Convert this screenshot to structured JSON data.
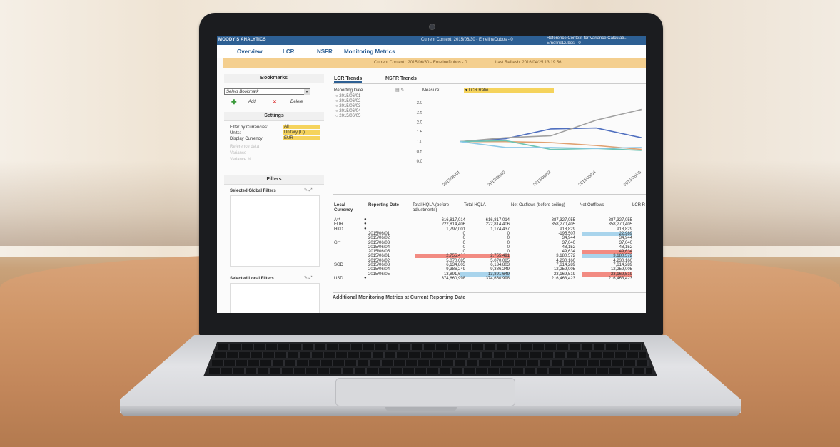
{
  "app": {
    "brand": "MOODY'S ANALYTICS",
    "current_context_top": "Current Context: 2015/06/30 - EmelineDubos - 0",
    "reference_context": "Reference Context for Variance Calculati... EmelineDubos - 0"
  },
  "nav": {
    "tabs": [
      "Overview",
      "LCR",
      "NSFR",
      "Monitoring Metrics"
    ]
  },
  "banner": {
    "current_context": "Current Context : 2015/06/30 - EmelineDubos - 0",
    "last_refresh": "Last Refresh: 2016/04/25 13:19:56"
  },
  "bookmarks": {
    "title": "Bookmarks",
    "select_placeholder": "Select Bookmark",
    "add_label": "Add",
    "delete_label": "Delete"
  },
  "settings": {
    "title": "Settings",
    "filter_label": "Filter by Currencies:",
    "filter_value": "All",
    "units_label": "Units:",
    "units_value": "Unitary (U)",
    "display_label": "Display Currency:",
    "display_value": "EUR",
    "reference_data": "Reference data",
    "variance": "Variance",
    "variance_pct": "Variance %"
  },
  "filters": {
    "title": "Filters",
    "global": "Selected Global Filters",
    "local": "Selected Local Filters"
  },
  "main": {
    "tabs": [
      "LCR Trends",
      "NSFR Trends"
    ],
    "reporting_date_label": "Reporting Date",
    "dates": [
      "2015/06/01",
      "2015/06/02",
      "2015/06/03",
      "2015/06/04",
      "2015/06/05"
    ],
    "measure_label": "Measure:",
    "measure_value": "LCR Ratio",
    "footer_title": "Additional Monitoring Metrics at Current Reporting Date"
  },
  "chart_data": {
    "type": "line",
    "x": [
      "2015/06/01",
      "2015/06/02",
      "2015/06/03",
      "2015/06/04",
      "2015/06/05"
    ],
    "y_ticks": [
      "0.0",
      "0.5",
      "1.0",
      "1.5",
      "2.0",
      "2.5",
      "3.0"
    ],
    "ylim": [
      0,
      3.0
    ],
    "series": [
      {
        "color": "#4f6fbf",
        "values": [
          1.0,
          1.15,
          1.65,
          1.7,
          1.2
        ]
      },
      {
        "color": "#a0a0a0",
        "values": [
          1.0,
          1.2,
          1.3,
          2.1,
          2.65
        ]
      },
      {
        "color": "#e0a070",
        "values": [
          1.0,
          1.0,
          0.95,
          0.8,
          0.6
        ]
      },
      {
        "color": "#6cc4b4",
        "values": [
          1.0,
          1.05,
          0.6,
          0.65,
          0.55
        ]
      },
      {
        "color": "#8cc8e8",
        "values": [
          1.0,
          0.7,
          0.7,
          0.65,
          0.7
        ]
      }
    ]
  },
  "table": {
    "headers": [
      "Local Currency",
      "Reporting Date",
      "Total HQLA (before adjustments)",
      "Total HQLA",
      "Net Outflows (before ceiling)",
      "Net Outflows",
      "LCR R"
    ],
    "rows": [
      {
        "cur": "A**",
        "date": "",
        "a": "616,817,014",
        "b": "616,817,014",
        "c": "887,327,055",
        "d": "887,327,055",
        "hb": "",
        "hd": ""
      },
      {
        "cur": "EUR",
        "date": "",
        "a": "222,814,406",
        "b": "222,814,406",
        "c": "358,270,405",
        "d": "358,270,405",
        "hb": "",
        "hd": ""
      },
      {
        "cur": "HKD",
        "date": "",
        "a": "1,797,001",
        "b": "1,174,437",
        "c": "918,829",
        "d": "918,829",
        "hb": "",
        "hd": ""
      },
      {
        "cur": "",
        "date": "2015/06/01",
        "a": "0",
        "b": "0",
        "c": "-195,507",
        "d": "22,989",
        "hb": "",
        "hd": "blue"
      },
      {
        "cur": "",
        "date": "2015/06/02",
        "a": "0",
        "b": "0",
        "c": "34,944",
        "d": "34,944",
        "hb": "",
        "hd": ""
      },
      {
        "cur": "G**",
        "date": "2015/06/03",
        "a": "0",
        "b": "0",
        "c": "37,040",
        "d": "37,040",
        "hb": "",
        "hd": ""
      },
      {
        "cur": "",
        "date": "2015/06/04",
        "a": "0",
        "b": "0",
        "c": "48,152",
        "d": "48,152",
        "hb": "",
        "hd": ""
      },
      {
        "cur": "",
        "date": "2015/06/05",
        "a": "0",
        "b": "0",
        "c": "49,634",
        "d": "49,634",
        "hb": "",
        "hd": "red"
      },
      {
        "cur": "",
        "date": "2015/06/01",
        "a": "2,755,491",
        "b": "2,755,491",
        "c": "3,180,572",
        "d": "3,180,572",
        "hb": "red",
        "hd": "blue"
      },
      {
        "cur": "",
        "date": "2015/06/02",
        "a": "5,070,085",
        "b": "5,070,085",
        "c": "4,230,160",
        "d": "4,230,160",
        "hb": "",
        "hd": ""
      },
      {
        "cur": "SGD",
        "date": "2015/06/03",
        "a": "6,134,803",
        "b": "6,134,803",
        "c": "7,614,289",
        "d": "7,614,289",
        "hb": "",
        "hd": ""
      },
      {
        "cur": "",
        "date": "2015/06/04",
        "a": "9,386,249",
        "b": "9,386,249",
        "c": "12,259,005",
        "d": "12,259,005",
        "hb": "",
        "hd": ""
      },
      {
        "cur": "",
        "date": "2015/06/05",
        "a": "13,891,649",
        "b": "13,891,649",
        "c": "23,169,519",
        "d": "23,169,519",
        "hb": "blue",
        "hd": "red"
      },
      {
        "cur": "USD",
        "date": "",
        "a": "374,660,998",
        "b": "374,660,998",
        "c": "216,463,423",
        "d": "216,463,423",
        "hb": "",
        "hd": ""
      }
    ]
  }
}
